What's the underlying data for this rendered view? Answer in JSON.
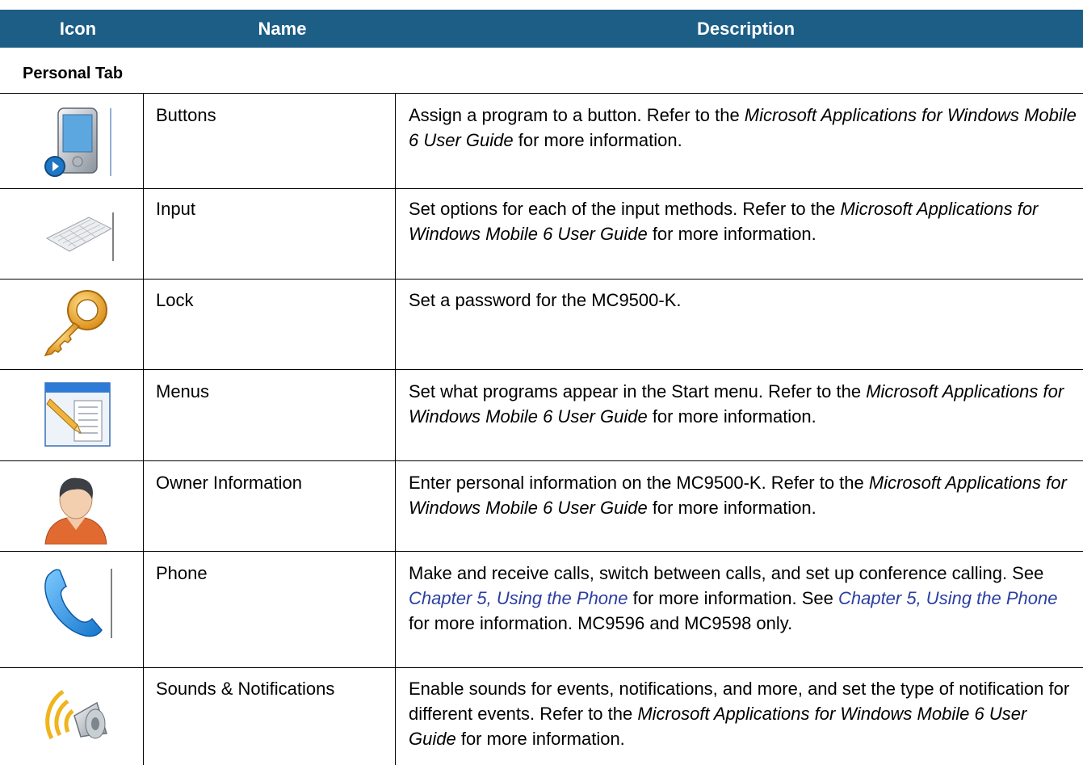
{
  "header": {
    "icon_col": "Icon",
    "name_col": "Name",
    "desc_col": "Description"
  },
  "section_title": "Personal Tab",
  "rows": [
    {
      "icon": "buttons-device-icon",
      "name": "Buttons",
      "desc": [
        {
          "t": "Assign a program to a button. Refer to the "
        },
        {
          "t": "Microsoft Applications for Windows Mobile 6 User Guide",
          "style": "italic"
        },
        {
          "t": " for more information."
        }
      ]
    },
    {
      "icon": "keyboard-icon",
      "name": "Input",
      "desc": [
        {
          "t": "Set options for each of the input methods. Refer to the "
        },
        {
          "t": "Microsoft Applications for Windows Mobile 6 User Guide",
          "style": "italic"
        },
        {
          "t": " for more information."
        }
      ]
    },
    {
      "icon": "key-icon",
      "name": "Lock",
      "desc": [
        {
          "t": "Set a password for the MC9500-K."
        }
      ]
    },
    {
      "icon": "menu-window-icon",
      "name": "Menus",
      "desc": [
        {
          "t": "Set what programs appear in the Start menu. Refer to the "
        },
        {
          "t": "Microsoft Applications for Windows Mobile 6 User Guide",
          "style": "italic"
        },
        {
          "t": " for more information."
        }
      ]
    },
    {
      "icon": "person-icon",
      "name": "Owner Information",
      "desc": [
        {
          "t": "Enter personal information on the MC9500-K. Refer to the "
        },
        {
          "t": "Microsoft Applications for Windows Mobile 6 User Guide",
          "style": "italic"
        },
        {
          "t": " for more information."
        }
      ]
    },
    {
      "icon": "phone-handset-icon",
      "name": "Phone",
      "desc": [
        {
          "t": "Make and receive calls, switch between calls, and set up conference calling. See "
        },
        {
          "t": "Chapter 5, Using the Phone",
          "style": "link"
        },
        {
          "t": " for more information. See "
        },
        {
          "t": "Chapter 5, Using the Phone",
          "style": "link"
        },
        {
          "t": " for more information. MC9596 and MC9598 only."
        }
      ]
    },
    {
      "icon": "speaker-sound-icon",
      "name": "Sounds & Notifications",
      "desc": [
        {
          "t": "Enable sounds for events, notifications, and more, and set the type of notification for different events. Refer to the "
        },
        {
          "t": "Microsoft Applications for Windows Mobile 6 User Guide",
          "style": "italic"
        },
        {
          "t": " for more information."
        }
      ]
    }
  ],
  "colors": {
    "header_bg": "#1c5e86",
    "header_text": "#ffffff",
    "link": "#2b3fa0"
  }
}
